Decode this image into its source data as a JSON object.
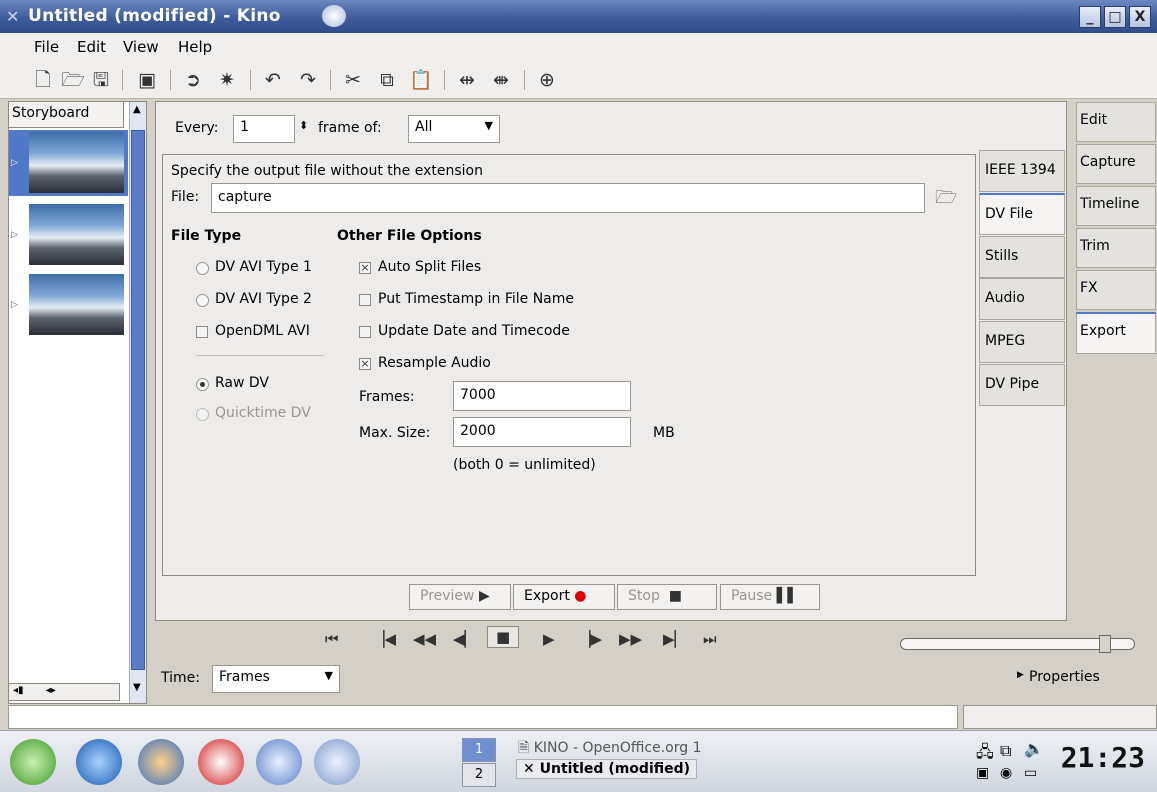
{
  "window": {
    "title": "Untitled (modified) - Kino",
    "minimize": "_",
    "maximize": "□",
    "close": "X"
  },
  "menu": {
    "file": "File",
    "edit": "Edit",
    "view": "View",
    "help": "Help"
  },
  "storyboard": {
    "tab_label": "Storyboard"
  },
  "export_header": {
    "every_label": "Every:",
    "every_value": "1",
    "frame_of_label": "frame of:",
    "frame_of_value": "All"
  },
  "dvfile": {
    "instruction": "Specify the output file without the extension",
    "file_label": "File:",
    "file_value": "capture",
    "file_type_heading": "File Type",
    "other_options_heading": "Other File Options",
    "dv_avi_type1": "DV AVI Type 1",
    "dv_avi_type2": "DV AVI Type 2",
    "opendml_avi": "OpenDML AVI",
    "raw_dv": "Raw DV",
    "quicktime_dv": "Quicktime DV",
    "auto_split": "Auto Split Files",
    "put_timestamp": "Put Timestamp in File Name",
    "update_date": "Update Date and Timecode",
    "resample_audio": "Resample Audio",
    "frames_label": "Frames:",
    "frames_value": "7000",
    "max_size_label": "Max. Size:",
    "max_size_value": "2000",
    "mb_unit": "MB",
    "note": "(both 0 = unlimited)"
  },
  "export_tabs": [
    "IEEE 1394",
    "DV File",
    "Stills",
    "Audio",
    "MPEG",
    "DV Pipe"
  ],
  "actions": {
    "preview": "Preview",
    "export": "Export",
    "stop": "Stop",
    "pause": "Pause"
  },
  "mode_tabs": [
    "Edit",
    "Capture",
    "Timeline",
    "Trim",
    "FX",
    "Export"
  ],
  "transport": {
    "time_label": "Time:",
    "time_format": "Frames",
    "properties": "Properties"
  },
  "taskbar": {
    "pager_1": "1",
    "pager_2": "2",
    "task_openoffice": "KINO - OpenOffice.org 1",
    "task_kino": "Untitled (modified)",
    "clock": "21:23"
  }
}
